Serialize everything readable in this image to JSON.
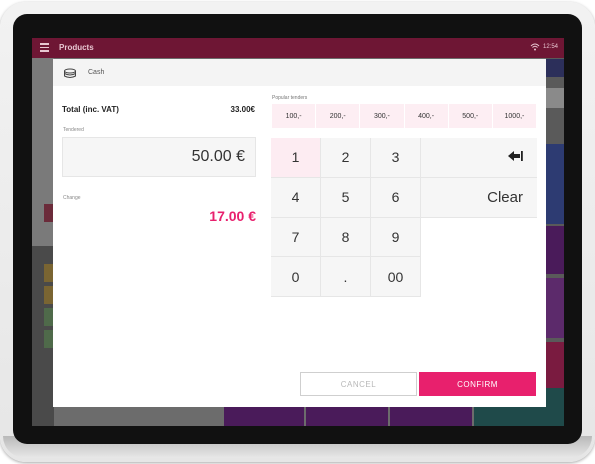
{
  "app": {
    "title": "Products",
    "time": "12:54",
    "wifi_icon": "wifi-icon",
    "menu_icon": "menu-icon"
  },
  "dialog": {
    "header": {
      "icon": "cash-icon",
      "label": "Cash"
    },
    "total": {
      "label": "Total (inc. VAT)",
      "value": "33.00€"
    },
    "tendered": {
      "label": "Tendered",
      "value": "50.00 €"
    },
    "change": {
      "label": "Change",
      "value": "17.00 €"
    },
    "popular": {
      "label": "Popular tenders",
      "tenders": [
        "100,-",
        "200,-",
        "300,-",
        "400,-",
        "500,-",
        "1000,-"
      ]
    },
    "keypad": {
      "keys": [
        "1",
        "2",
        "3",
        "4",
        "5",
        "6",
        "7",
        "8",
        "9",
        "0",
        ".",
        "00"
      ],
      "backspace_icon": "backspace-icon",
      "clear_label": "Clear"
    },
    "buttons": {
      "cancel": "CANCEL",
      "confirm": "CONFIRM"
    }
  },
  "colors": {
    "accent": "#e8206d",
    "header_bar": "#6e1634",
    "tender_bg": "#fdeef3"
  }
}
